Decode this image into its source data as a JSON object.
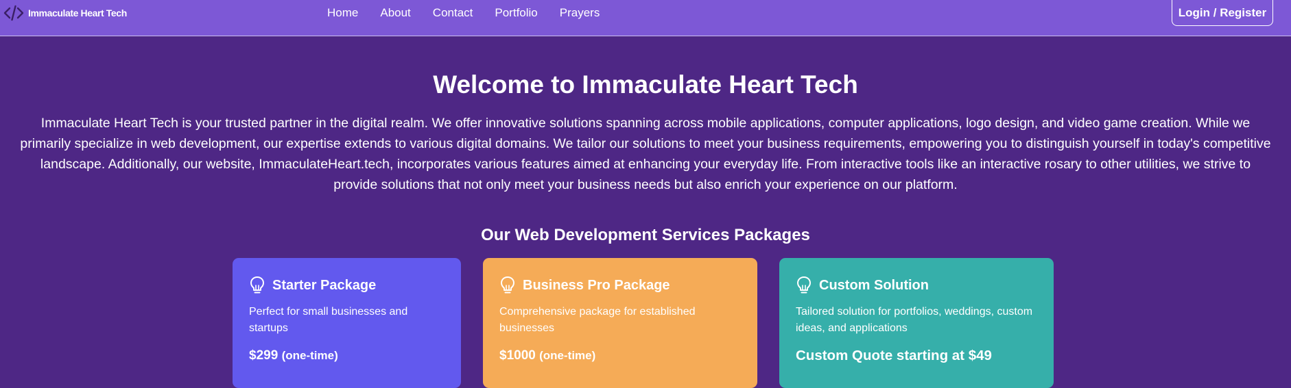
{
  "nav": {
    "brand": "Immaculate Heart Tech",
    "brand_icon": "code-icon",
    "links": [
      {
        "label": "Home"
      },
      {
        "label": "About"
      },
      {
        "label": "Contact"
      },
      {
        "label": "Portfolio"
      },
      {
        "label": "Prayers"
      }
    ],
    "login_label": "Login / Register"
  },
  "hero": {
    "title": "Welcome to Immaculate Heart Tech",
    "text": "Immaculate Heart Tech is your trusted partner in the digital realm. We offer innovative solutions spanning across mobile applications, computer applications, logo design, and video game creation. While we primarily specialize in web development, our expertise extends to various digital domains. We tailor our solutions to meet your business requirements, empowering you to distinguish yourself in today's competitive landscape. Additionally, our website, ImmaculateHeart.tech, incorporates various features aimed at enhancing your everyday life. From interactive tools like an interactive rosary to other utilities, we strive to provide solutions that not only meet your business needs but also enrich your experience on our platform."
  },
  "packages": {
    "heading": "Our Web Development Services Packages",
    "items": [
      {
        "icon": "lightbulb-icon",
        "title": "Starter Package",
        "description": "Perfect for small businesses and startups",
        "price": "$299",
        "price_note": "(one-time)",
        "color": "#6259ee"
      },
      {
        "icon": "lightbulb-icon",
        "title": "Business Pro Package",
        "description": "Comprehensive package for established businesses",
        "price": "$1000",
        "price_note": "(one-time)",
        "color": "#f5ab57"
      },
      {
        "icon": "lightbulb-icon",
        "title": "Custom Solution",
        "description": "Tailored solution for portfolios, weddings, custom ideas, and applications",
        "price": "Custom Quote starting at $49",
        "color": "#36afaa"
      }
    ]
  },
  "colors": {
    "page_background": "#4e2785",
    "navbar": "#7d58d6",
    "text": "#ffffff"
  }
}
